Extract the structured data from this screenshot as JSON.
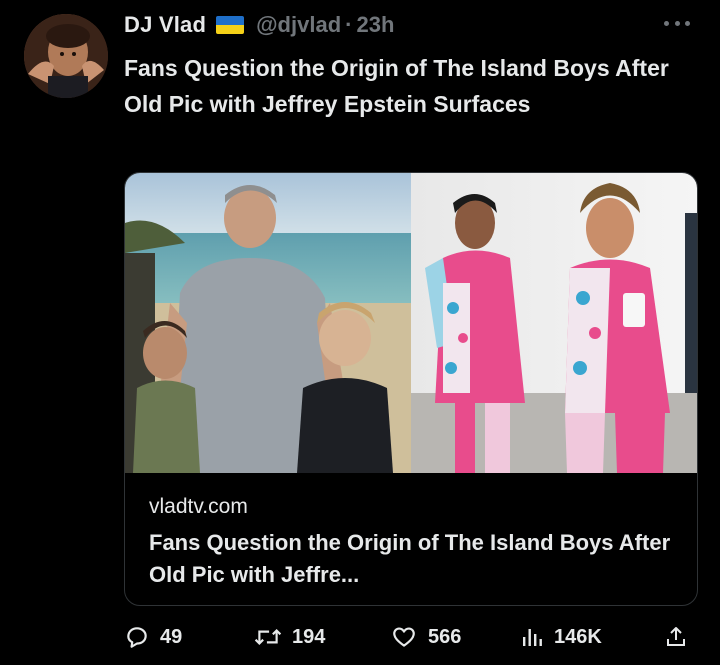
{
  "author": {
    "display_name": "DJ Vlad",
    "handle": "@djvlad",
    "separator": "·",
    "time": "23h",
    "verified_flag": "ukraine-flag-icon"
  },
  "tweet": {
    "text": "Fans Question the Origin of The Island Boys After Old Pic with Jeffrey Epstein Surfaces"
  },
  "card": {
    "domain": "vladtv.com",
    "title": "Fans Question the Origin of The Island Boys After Old Pic with Jeffre..."
  },
  "actions": {
    "replies": "49",
    "retweets": "194",
    "likes": "566",
    "views": "146K"
  },
  "icons": {
    "more": "more-icon",
    "reply": "reply-icon",
    "retweet": "retweet-icon",
    "like": "heart-icon",
    "views": "views-icon",
    "share": "share-icon"
  },
  "colors": {
    "background": "#000000",
    "text": "#e7e9ea",
    "secondary": "#71767b",
    "border": "#2f3336",
    "flag_blue": "#1f6fc9",
    "flag_yellow": "#f5d118"
  }
}
